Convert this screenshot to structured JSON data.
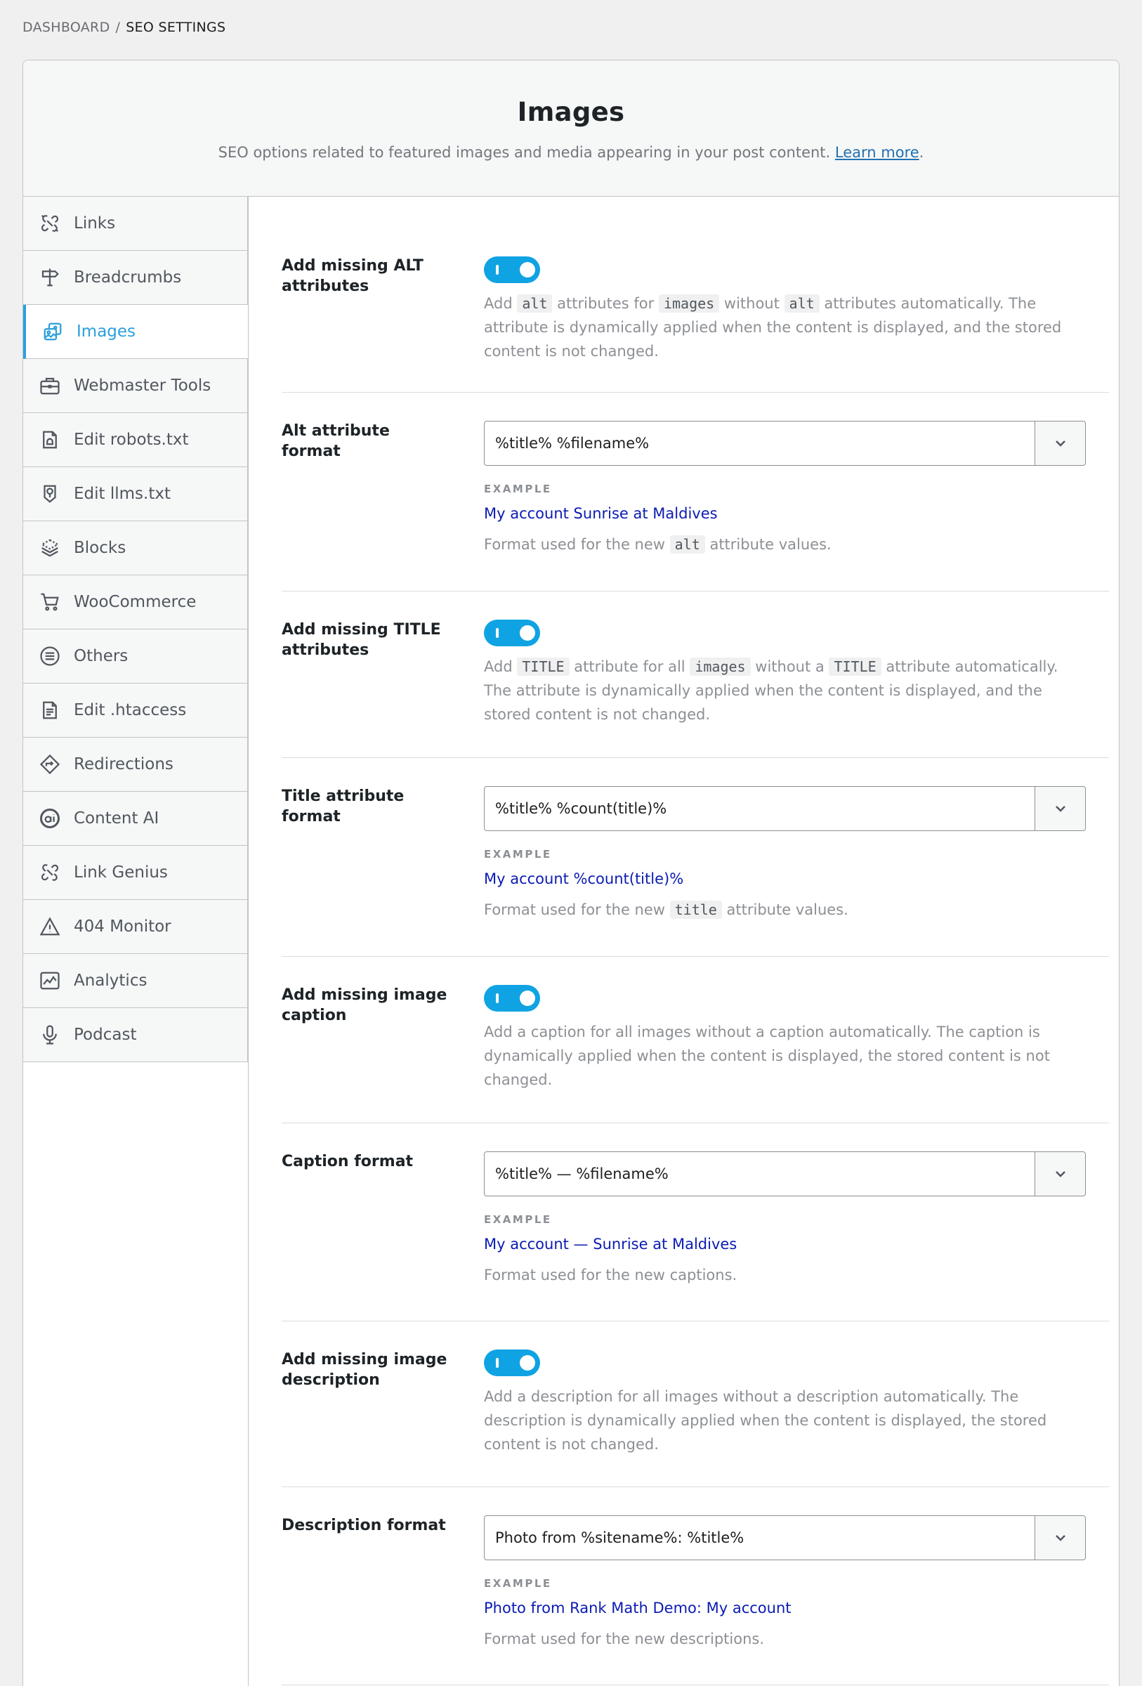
{
  "breadcrumb": {
    "parent": "DASHBOARD",
    "separator": "/",
    "current": "SEO SETTINGS"
  },
  "header": {
    "title": "Images",
    "subtitle": "SEO options related to featured images and media appearing in your post content.",
    "learn_more": "Learn more"
  },
  "sidebar": {
    "items": [
      {
        "label": "Links",
        "icon": "link-broken-icon"
      },
      {
        "label": "Breadcrumbs",
        "icon": "signpost-icon"
      },
      {
        "label": "Images",
        "icon": "images-icon",
        "active": true
      },
      {
        "label": "Webmaster Tools",
        "icon": "briefcase-icon"
      },
      {
        "label": "Edit robots.txt",
        "icon": "robot-file-icon"
      },
      {
        "label": "Edit llms.txt",
        "icon": "llms-file-icon"
      },
      {
        "label": "Blocks",
        "icon": "blocks-icon"
      },
      {
        "label": "WooCommerce",
        "icon": "cart-icon"
      },
      {
        "label": "Others",
        "icon": "list-circle-icon"
      },
      {
        "label": "Edit .htaccess",
        "icon": "document-icon"
      },
      {
        "label": "Redirections",
        "icon": "redirect-diamond-icon"
      },
      {
        "label": "Content AI",
        "icon": "content-ai-icon"
      },
      {
        "label": "Link Genius",
        "icon": "link-genius-icon"
      },
      {
        "label": "404 Monitor",
        "icon": "warning-icon"
      },
      {
        "label": "Analytics",
        "icon": "analytics-chart-icon"
      },
      {
        "label": "Podcast",
        "icon": "microphone-icon"
      }
    ]
  },
  "settings": {
    "alt_toggle": {
      "label": "Add missing ALT attributes",
      "enabled": true,
      "desc_1": "Add",
      "code_1": "alt",
      "desc_2": "attributes for",
      "code_2": "images",
      "desc_3": "without",
      "code_3": "alt",
      "desc_4": "attributes automatically. The attribute is dynamically applied when the content is displayed, and the stored content is not changed."
    },
    "alt_format": {
      "label": "Alt attribute format",
      "value": "%title% %filename%",
      "example_label": "EXAMPLE",
      "example": "My account Sunrise at Maldives",
      "note_1": "Format used for the new",
      "note_code": "alt",
      "note_2": "attribute values."
    },
    "title_toggle": {
      "label": "Add missing TITLE attributes",
      "enabled": true,
      "desc_1": "Add",
      "code_1": "TITLE",
      "desc_2": "attribute for all",
      "code_2": "images",
      "desc_3": "without a",
      "code_3": "TITLE",
      "desc_4": "attribute automatically. The attribute is dynamically applied when the content is displayed, and the stored content is not changed."
    },
    "title_format": {
      "label": "Title attribute format",
      "value": "%title% %count(title)%",
      "example_label": "EXAMPLE",
      "example": "My account %count(title)%",
      "note_1": "Format used for the new",
      "note_code": "title",
      "note_2": "attribute values."
    },
    "caption_toggle": {
      "label": "Add missing image caption",
      "enabled": true,
      "desc": "Add a caption for all images without a caption automatically. The caption is dynamically applied when the content is displayed, the stored content is not changed."
    },
    "caption_format": {
      "label": "Caption format",
      "value": "%title% — %filename%",
      "example_label": "EXAMPLE",
      "example": "My account — Sunrise at Maldives",
      "note": "Format used for the new captions."
    },
    "description_toggle": {
      "label": "Add missing image description",
      "enabled": true,
      "desc": "Add a description for all images without a description automatically. The description is dynamically applied when the content is displayed, the stored content is not changed."
    },
    "description_format": {
      "label": "Description format",
      "value": "Photo from %sitename%: %title%",
      "example_label": "EXAMPLE",
      "example": "Photo from Rank Math Demo: My account",
      "note": "Format used for the new descriptions."
    }
  },
  "colors": {
    "accent": "#10a3e3",
    "active_nav": "#2b9fdc",
    "example_text": "#0b1bb3"
  }
}
